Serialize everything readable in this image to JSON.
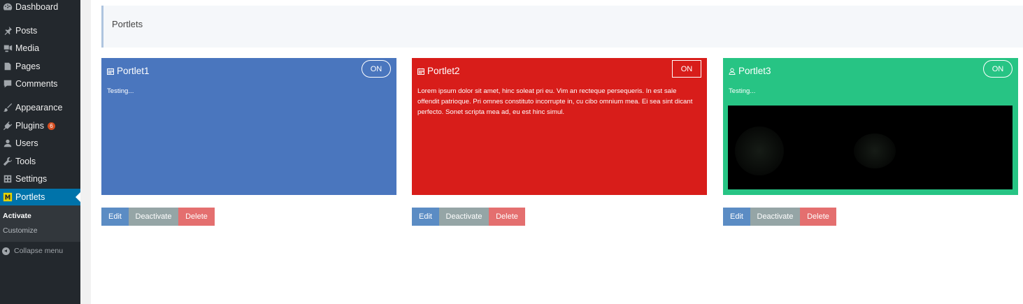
{
  "sidebar": {
    "items": [
      {
        "label": "Dashboard",
        "icon": "dashboard-icon"
      },
      {
        "label": "Posts",
        "icon": "pin-icon"
      },
      {
        "label": "Media",
        "icon": "media-icon"
      },
      {
        "label": "Pages",
        "icon": "pages-icon"
      },
      {
        "label": "Comments",
        "icon": "comments-icon"
      },
      {
        "label": "Appearance",
        "icon": "brush-icon"
      },
      {
        "label": "Plugins",
        "icon": "plugin-icon",
        "badge": "6"
      },
      {
        "label": "Users",
        "icon": "users-icon"
      },
      {
        "label": "Tools",
        "icon": "wrench-icon"
      },
      {
        "label": "Settings",
        "icon": "settings-icon"
      },
      {
        "label": "Portlets",
        "icon": "portlets-icon",
        "active": true
      }
    ],
    "submenu": [
      {
        "label": "Activate",
        "current": true
      },
      {
        "label": "Customize"
      }
    ],
    "collapse_label": "Collapse menu"
  },
  "header": {
    "title": "Portlets"
  },
  "portlets": [
    {
      "title": "Portlet1",
      "icon": "calendar-icon",
      "toggle": "ON",
      "body": "Testing...",
      "color": "#4a76be"
    },
    {
      "title": "Portlet2",
      "icon": "calendar-icon",
      "toggle": "ON",
      "body": "Lorem ipsum dolor sit amet, hinc soleat pri eu. Vim an recteque persequeris. In est sale offendit patrioque. Pri omnes constituto incorrupte in, cu cibo omnium mea. Ei sea sint dicant perfecto. Sonet scripta mea ad, eu est hinc simul.",
      "color": "#d81d1a"
    },
    {
      "title": "Portlet3",
      "icon": "user-icon",
      "toggle": "ON",
      "body": "Testing...",
      "color": "#27c484"
    }
  ],
  "actions": {
    "edit": "Edit",
    "deactivate": "Deactivate",
    "delete": "Delete"
  },
  "colors": {
    "sidebar_bg": "#23282d",
    "active_menu": "#0073aa",
    "edit": "#5b8cc4",
    "deactivate": "#95a5a6",
    "delete": "#e46f6f"
  }
}
